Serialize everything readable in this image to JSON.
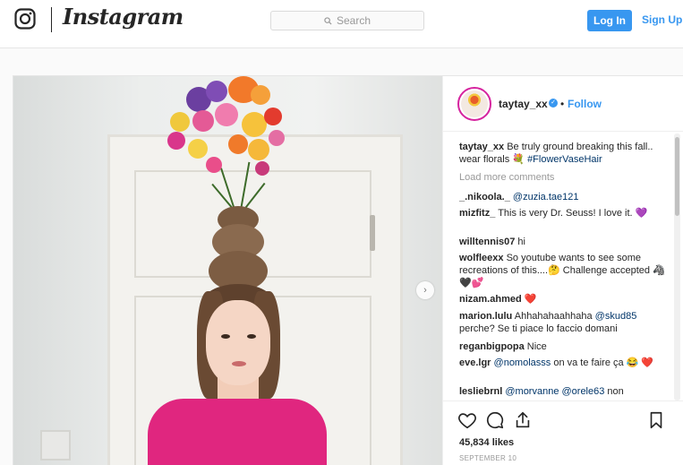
{
  "header": {
    "brand": "Instagram",
    "search_placeholder": "Search",
    "login_label": "Log In",
    "signup_label": "Sign Up"
  },
  "post": {
    "username": "taytay_xx",
    "follow_label": "Follow",
    "separator": "•",
    "caption": {
      "user": "taytay_xx",
      "text": "Be truly ground breaking this fall.. wear florals 💐",
      "hashtag": "#FlowerVaseHair"
    },
    "load_more_label": "Load more comments",
    "comments": [
      {
        "user": "_.nikoola._",
        "mention": "@zuzia.tae121",
        "text": ""
      },
      {
        "user": "mizfitz_",
        "mention": "",
        "text": "This is very Dr. Seuss! I love it. 💜"
      },
      {
        "user": "willtennis07",
        "mention": "",
        "text": "hi"
      },
      {
        "user": "wolfleexx",
        "mention": "",
        "text": "So youtube wants to see some recreations of this....🤔 Challenge accepted 🦓🖤💕"
      },
      {
        "user": "nizam.ahmed",
        "mention": "",
        "text": "❤️"
      },
      {
        "user": "marion.lulu",
        "mention": "@skud85",
        "text": "Ahhahahaahhaha",
        "text_after": "perche? Se ti piace lo faccio domani"
      },
      {
        "user": "reganbigpopa",
        "mention": "",
        "text": "Nice"
      },
      {
        "user": "eve.lgr",
        "mention": "@nomolasss",
        "text": "",
        "text_after": "on va te faire ça 😂 ❤️"
      },
      {
        "user": "lesliebrnl",
        "mention": "@morvanne @orele63",
        "text": "",
        "text_after": "non"
      }
    ],
    "likes": "45,834 likes",
    "date": "SEPTEMBER 10"
  },
  "icons": {
    "logo": "instagram-glyph-icon",
    "search": "search-icon",
    "next": "chevron-right-icon",
    "like": "heart-icon",
    "comment": "comment-icon",
    "share": "share-icon",
    "save": "bookmark-icon",
    "verified": "verified-badge-icon"
  },
  "colors": {
    "accent": "#3897f0",
    "text": "#262626",
    "muted": "#999999",
    "shirt": "#e0267f"
  }
}
